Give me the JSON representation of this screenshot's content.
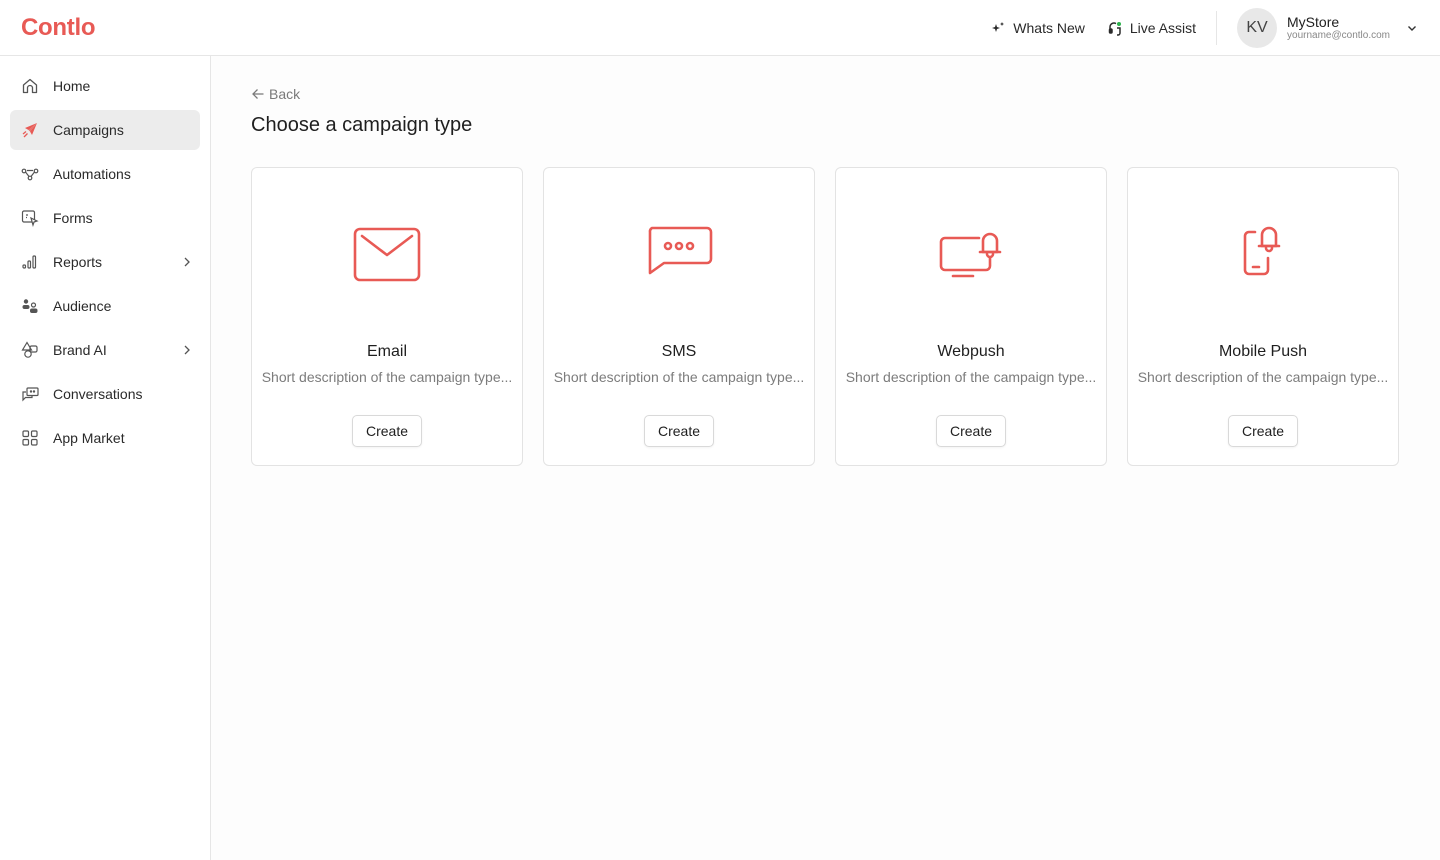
{
  "app": {
    "logo": "Contlo",
    "accent": "#e85a55"
  },
  "header": {
    "whats_new": "Whats New",
    "live_assist": "Live Assist",
    "account": {
      "initials": "KV",
      "name": "MyStore",
      "email": "yourname@contlo.com"
    }
  },
  "sidebar": {
    "items": [
      {
        "label": "Home",
        "icon": "home-icon",
        "active": false,
        "has_submenu": false
      },
      {
        "label": "Campaigns",
        "icon": "paper-plane-icon",
        "active": true,
        "has_submenu": false
      },
      {
        "label": "Automations",
        "icon": "workflow-icon",
        "active": false,
        "has_submenu": false
      },
      {
        "label": "Forms",
        "icon": "form-icon",
        "active": false,
        "has_submenu": false
      },
      {
        "label": "Reports",
        "icon": "bar-chart-icon",
        "active": false,
        "has_submenu": true
      },
      {
        "label": "Audience",
        "icon": "users-icon",
        "active": false,
        "has_submenu": false
      },
      {
        "label": "Brand AI",
        "icon": "shapes-icon",
        "active": false,
        "has_submenu": true
      },
      {
        "label": "Conversations",
        "icon": "chat-icon",
        "active": false,
        "has_submenu": false
      },
      {
        "label": "App Market",
        "icon": "grid-icon",
        "active": false,
        "has_submenu": false
      }
    ]
  },
  "main": {
    "back_label": "Back",
    "title": "Choose a campaign type",
    "cards": [
      {
        "title": "Email",
        "description": "Short description of the campaign type...",
        "button": "Create",
        "icon": "envelope-icon"
      },
      {
        "title": "SMS",
        "description": "Short description of the campaign type...",
        "button": "Create",
        "icon": "sms-bubble-icon"
      },
      {
        "title": "Webpush",
        "description": "Short description of the campaign type...",
        "button": "Create",
        "icon": "monitor-bell-icon"
      },
      {
        "title": "Mobile Push",
        "description": "Short description of the campaign type...",
        "button": "Create",
        "icon": "phone-bell-icon"
      }
    ]
  }
}
